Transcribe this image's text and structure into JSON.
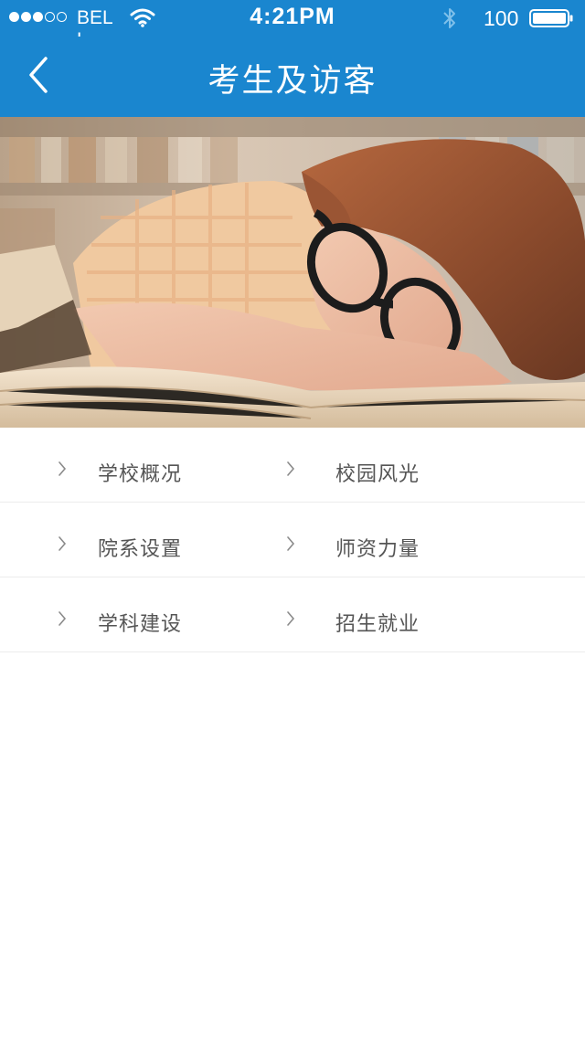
{
  "status_bar": {
    "carrier": "BELL",
    "time": "4:21PM",
    "battery_percent": "100",
    "signal_bars_filled": 3,
    "signal_bars_total": 5,
    "icons": [
      "signal-dots-icon",
      "wifi-icon",
      "bluetooth-icon",
      "battery-icon"
    ]
  },
  "nav": {
    "title": "考生及访客",
    "back_icon": "chevron-left-icon"
  },
  "hero": {
    "image_description_icon": "hero-banner-image"
  },
  "menu": {
    "rows": [
      {
        "left": {
          "label": "学校概况",
          "icon": "chevron-right-icon"
        },
        "right": {
          "label": "校园风光",
          "icon": "chevron-right-icon"
        }
      },
      {
        "left": {
          "label": "院系设置",
          "icon": "chevron-right-icon"
        },
        "right": {
          "label": "师资力量",
          "icon": "chevron-right-icon"
        }
      },
      {
        "left": {
          "label": "学科建设",
          "icon": "chevron-right-icon"
        },
        "right": {
          "label": "招生就业",
          "icon": "chevron-right-icon"
        }
      }
    ]
  },
  "colors": {
    "primary": "#1a86cf",
    "text": "#555555",
    "divider": "#ececec"
  }
}
